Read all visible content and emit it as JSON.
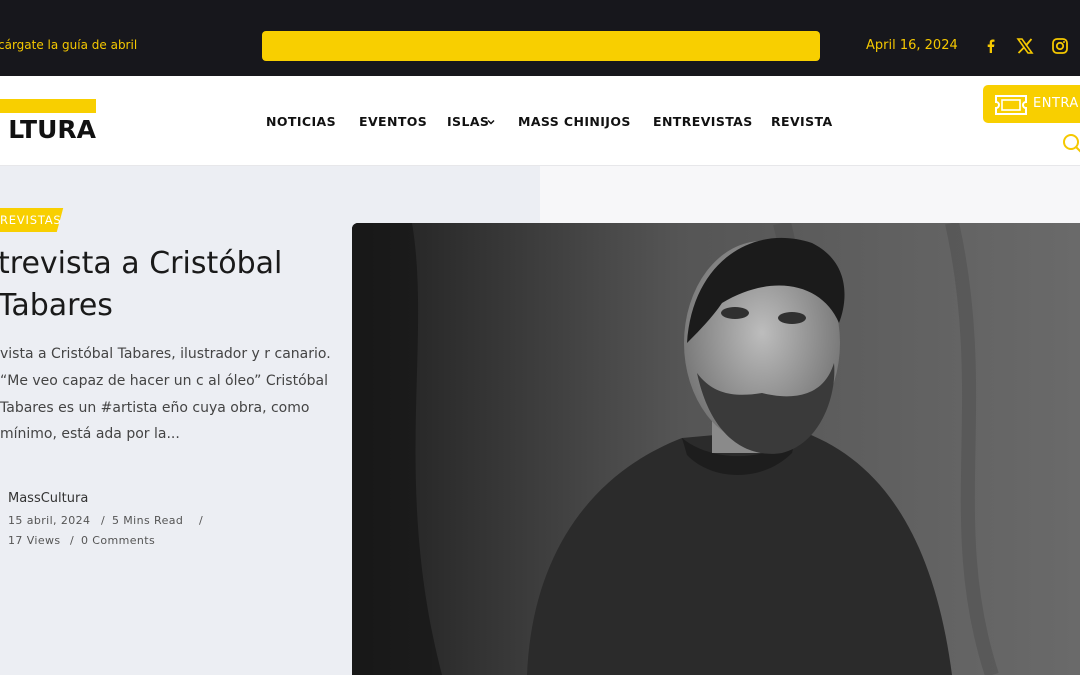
{
  "topbar": {
    "promo_text": "cárgate la guía de abril",
    "date": "April 16, 2024",
    "social_icons": [
      "facebook-icon",
      "x-twitter-icon",
      "instagram-icon"
    ],
    "accent_color": "#f8cf00",
    "background_color": "#17171c"
  },
  "header": {
    "logo_text": "LTURA",
    "nav": [
      {
        "label": "NOTICIAS"
      },
      {
        "label": "EVENTOS"
      },
      {
        "label": "ISLAS"
      },
      {
        "label": "MASS CHINIJOS"
      },
      {
        "label": "ENTREVISTAS"
      },
      {
        "label": "REVISTA"
      }
    ],
    "entrar_label": "ENTRAR"
  },
  "featured": {
    "category": "REVISTAS",
    "title": "trevista a Cristóbal Tabares",
    "excerpt": "vista a Cristóbal Tabares, ilustrador y r canario. “Me veo capaz de hacer un c al óleo” Cristóbal Tabares es un #artista eño cuya obra, como mínimo, está ada por la...",
    "author": "MassCultura",
    "date": "15 abril, 2024",
    "read_time": "5 Mins Read",
    "views": "17 Views",
    "comments": "0 Comments",
    "image_alt": "black-and-white portrait photo"
  }
}
